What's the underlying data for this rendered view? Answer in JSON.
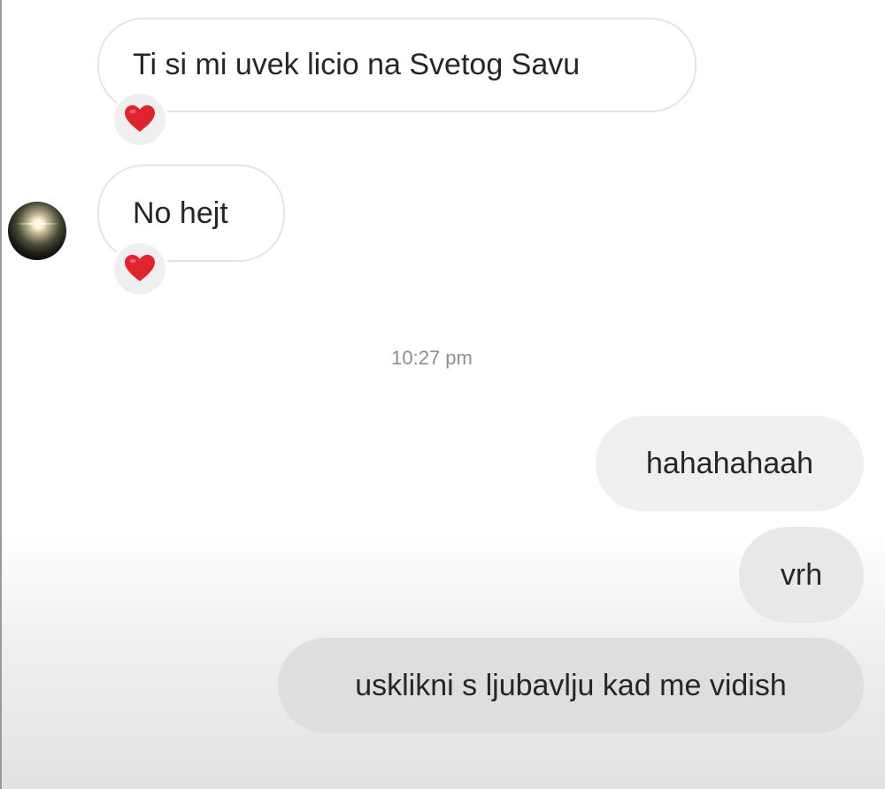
{
  "conversation": {
    "incoming": [
      {
        "text": "Ti si mi uvek licio na Svetog Savu",
        "reaction": "red-heart"
      },
      {
        "text": "No hejt",
        "reaction": "red-heart"
      }
    ],
    "timestamp": "10:27 pm",
    "outgoing": [
      {
        "text": "hahahahaah"
      },
      {
        "text": "vrh"
      },
      {
        "text": "usklikni s ljubavlju kad me vidish"
      }
    ]
  },
  "colors": {
    "incoming_bubble": "#ffffff",
    "outgoing_bubble": "#efefef",
    "heart": "#e0242f",
    "timestamp": "#8e8e8e"
  }
}
